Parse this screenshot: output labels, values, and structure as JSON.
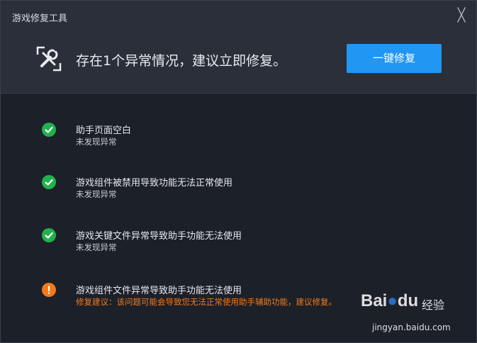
{
  "window": {
    "title": "游戏修复工具",
    "close_glyph": "╳"
  },
  "header": {
    "message": "存在1个异常情况，建议立即修复。",
    "fix_button_label": "一键修复",
    "icon": "wrench-screwdriver-icon"
  },
  "colors": {
    "ok": "#22b14c",
    "warn": "#f07a1d",
    "accent": "#2196f3",
    "background": "#1c2029"
  },
  "checks": [
    {
      "status": "ok",
      "icon": "check-circle-icon",
      "title": "助手页面空白",
      "detail": "未发现异常"
    },
    {
      "status": "ok",
      "icon": "check-circle-icon",
      "title": "游戏组件被禁用导致功能无法正常使用",
      "detail": "未发现异常"
    },
    {
      "status": "ok",
      "icon": "check-circle-icon",
      "title": "游戏关键文件异常导致助手功能无法使用",
      "detail": "未发现异常"
    },
    {
      "status": "warn",
      "icon": "exclamation-circle-icon",
      "title": "游戏组件文件异常导致助手功能无法使用",
      "detail": "修复建议：该问题可能会导致您无法正常使用助手辅助功能，建议修复。"
    }
  ],
  "watermark": {
    "logo": "Bai",
    "logo_suffix": "du",
    "label": "经验",
    "url": "jingyan.baidu.com"
  }
}
